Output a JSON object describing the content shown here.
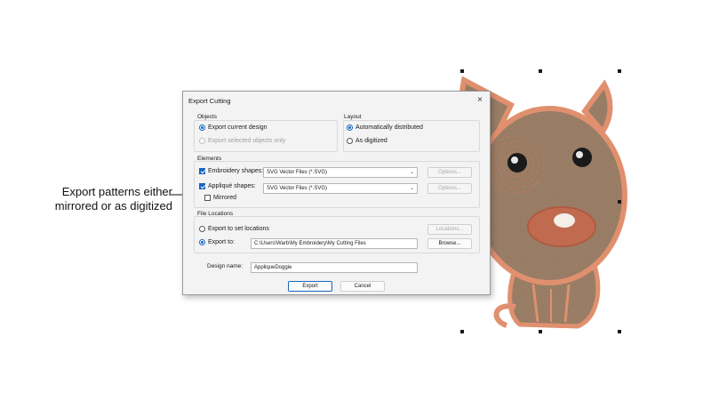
{
  "callout": {
    "text": "Export patterns either mirrored or as digitized"
  },
  "dialog": {
    "title": "Export Cutting",
    "close_icon": "×",
    "objects": {
      "label": "Objects",
      "export_current": "Export current design",
      "export_selected": "Export selected objects only"
    },
    "layout": {
      "label": "Layout",
      "auto_distributed": "Automatically distributed",
      "as_digitized": "As digitized"
    },
    "elements": {
      "label": "Elements",
      "embroidery_label": "Embroidery shapes:",
      "embroidery_value": "SVG Vector Files (*.SVG)",
      "applique_label": "Appliqué shapes:",
      "applique_value": "SVG Vector Files (*.SVG)",
      "options_label": "Options...",
      "mirrored_label": "Mirrored"
    },
    "file_locations": {
      "label": "File Locations",
      "export_to_set": "Export to set locations",
      "locations_button": "Locations...",
      "export_to": "Export to:",
      "path": "C:\\Users\\Warb\\My Embroidery\\My Cutting Files",
      "browse_button": "Browse..."
    },
    "design_name_label": "Design name:",
    "design_name_value": "AppliqueDoggie",
    "export_button": "Export",
    "cancel_button": "Cancel"
  },
  "colors": {
    "accent": "#1565c0",
    "dog_outline": "#e0906e",
    "dog_fill": "#9c8068"
  }
}
